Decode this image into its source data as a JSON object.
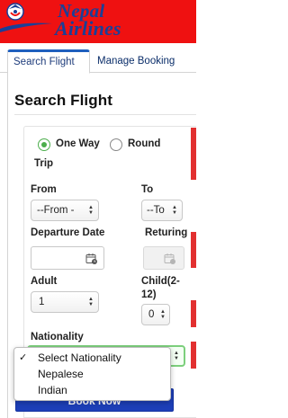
{
  "header": {
    "brand_line1": "Nepal",
    "brand_line2": "Airlines",
    "colors": {
      "background": "#ef1111",
      "brand_text": "#1a3f97"
    },
    "logo_icon": "airline-emblem-icon"
  },
  "tabs": [
    {
      "label": "Search Flight",
      "active": true
    },
    {
      "label": "Manage Booking",
      "active": false
    }
  ],
  "form": {
    "title": "Search Flight",
    "trip_type": {
      "options": [
        "One Way",
        "Round"
      ],
      "round_suffix": "Trip",
      "selected": "One Way"
    },
    "from": {
      "label": "From",
      "value": "--From -"
    },
    "to": {
      "label": "To",
      "value": "--To"
    },
    "departure": {
      "label": "Departure Date",
      "icon": "calendar-icon"
    },
    "return": {
      "label": "Returing",
      "icon": "calendar-icon"
    },
    "adult": {
      "label": "Adult",
      "value": "1"
    },
    "child": {
      "label_line1": "Child(2-",
      "label_line2": "12)",
      "value": "0"
    },
    "nationality": {
      "label": "Nationality",
      "options": [
        "Select Nationality",
        "Nepalese",
        "Indian"
      ],
      "selected": "Select Nationality"
    },
    "search_button": "Book Now"
  },
  "colors": {
    "accent_blue": "#1e5fbe",
    "radio_green": "#4cae4c",
    "focus_green": "#7ccf7c",
    "button_blue": "#1d3fb8"
  }
}
